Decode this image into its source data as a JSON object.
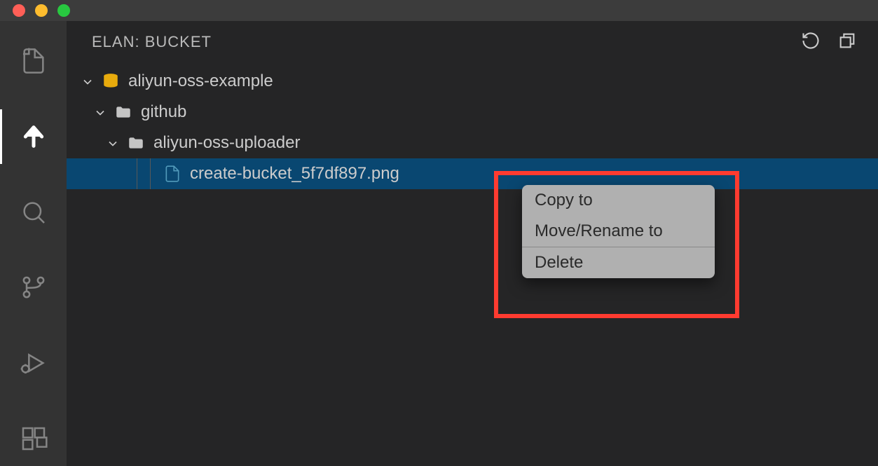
{
  "sidebar": {
    "title": "ELAN: BUCKET"
  },
  "tree": {
    "bucket": "aliyun-oss-example",
    "folder1": "github",
    "folder2": "aliyun-oss-uploader",
    "file": "create-bucket_5f7df897.png"
  },
  "context_menu": {
    "copy_to": "Copy to",
    "move_rename": "Move/Rename to",
    "delete": "Delete"
  }
}
